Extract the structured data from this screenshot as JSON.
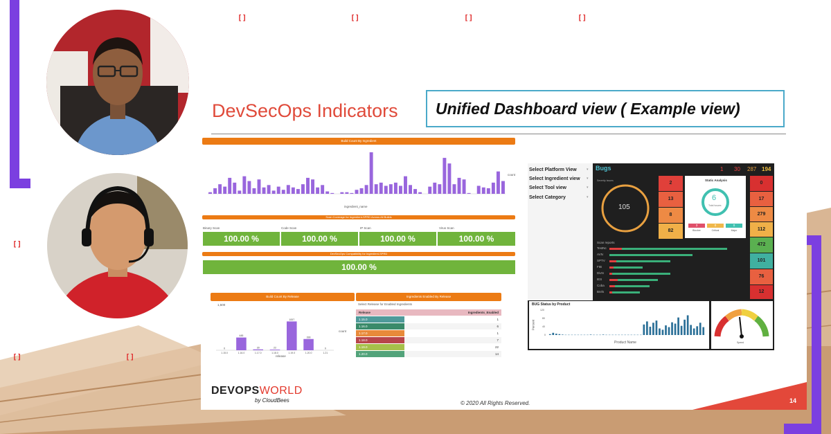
{
  "slide": {
    "title": "DevSecOps Indicators",
    "banner": "Unified Dashboard view ( Example view)",
    "footer_brand_a": "DEVOPS",
    "footer_brand_b": "WORLD",
    "footer_sub": "by CloudBees",
    "copyright": "© 2020 All Rights Reserved.",
    "page_number": "14"
  },
  "window_icons": [
    "[]",
    "[]",
    "[]",
    "[]",
    "[]",
    "[]",
    "[]"
  ],
  "build_count_ingredient": {
    "header": "Build Count By Ingredient",
    "legend": "count",
    "xlabel": "ingredient_name"
  },
  "coverage": {
    "header": "Scan Coverage for Ingredient-SPRD Across All Builds",
    "labels": [
      "Binary Scan",
      "Code Scan",
      "IP Scan",
      "Virus Scan"
    ],
    "values": [
      "100.00 %",
      "100.00 %",
      "100.00 %",
      "100.00 %"
    ],
    "compat_header": "DevSecOps Compatibility for Ingredient-SPRD",
    "compat_value": "100.00 %"
  },
  "build_count_release": {
    "header": "Build Count By Release",
    "legend": "count",
    "xlabel": "release",
    "ylabel": "count",
    "ytick_top": "1,500"
  },
  "ingredients_release": {
    "header": "Ingredients Enabled By Release",
    "subheader": "Select Release for Enabled Ingredients",
    "col_release": "Release",
    "col_enabled": "Ingredients_Enabled",
    "rows": [
      {
        "release": "1.15.0",
        "count": "1",
        "color": "#4f9a9a"
      },
      {
        "release": "1.16.0",
        "count": "6",
        "color": "#3a8a6a"
      },
      {
        "release": "1.17.0",
        "count": "1",
        "color": "#e88a3a"
      },
      {
        "release": "1.18.0",
        "count": "7",
        "color": "#b8454a"
      },
      {
        "release": "1.19.0",
        "count": "22",
        "color": "#a6c04a"
      },
      {
        "release": "1.20.0",
        "count": "14",
        "color": "#52a37a"
      }
    ]
  },
  "dashboard": {
    "filters": [
      "Select Platform View",
      "Select Ingredient view",
      "Select Tool view",
      "Select Category"
    ],
    "bugs_title": "Bugs",
    "counts": [
      "1",
      "30",
      "287",
      "194"
    ],
    "gauge_value": "105",
    "severity_label": "Severity Issues",
    "static_title": "Static Analysis",
    "static_total": "6",
    "static_total_label": "Total Issues",
    "static_tiles": [
      {
        "value": "3",
        "label": "Blocker",
        "color": "#e0506a"
      },
      {
        "value": "0",
        "label": "Critical",
        "color": "#f0b84a"
      },
      {
        "value": "0",
        "label": "Major",
        "color": "#40c0b0"
      }
    ],
    "mid_cells": [
      "2",
      "13",
      "8",
      "82"
    ],
    "right_cells": [
      "0",
      "17",
      "279",
      "112",
      "472",
      "101",
      "76",
      "12"
    ],
    "scan_title": "Scan reports",
    "scan_labels": [
      "TestNc",
      "AVN",
      "SPTV",
      "FIB",
      "DivN",
      "IES",
      "Coba",
      "Bnrls"
    ],
    "bug_status_title": "BUG Status by Product",
    "bug_status_ylabel": "Percent",
    "bug_status_xlabel": "Product Name",
    "bug_yticks": [
      "120",
      "80",
      "40",
      "0"
    ],
    "gauge_label": "Speed"
  },
  "chart_data": [
    {
      "type": "bar",
      "title": "Build Count By Ingredient",
      "xlabel": "ingredient_name",
      "legend": [
        "count"
      ],
      "values": [
        2,
        7,
        12,
        9,
        20,
        14,
        4,
        22,
        16,
        7,
        18,
        8,
        11,
        4,
        9,
        5,
        11,
        8,
        6,
        12,
        20,
        18,
        8,
        11,
        3,
        1,
        0,
        2,
        2,
        1,
        5,
        7,
        11,
        52,
        12,
        14,
        10,
        12,
        14,
        10,
        22,
        11,
        6,
        2,
        0,
        9,
        14,
        12,
        45,
        38,
        12,
        20,
        18,
        1,
        0,
        10,
        8,
        7,
        14,
        28,
        16
      ]
    },
    {
      "type": "bar",
      "title": "Build Count By Release",
      "xlabel": "release",
      "ylabel": "count",
      "legend": [
        "count"
      ],
      "categories": [
        "1.15.0",
        "1.16.0",
        "1.17.0",
        "1.18.0",
        "1.19.0",
        "1.20.0",
        "1.21"
      ],
      "values": [
        0,
        445,
        30,
        22,
        1007,
        393,
        0
      ],
      "labels": [
        "0",
        "445",
        "30",
        "22",
        "1007",
        "393",
        "0"
      ],
      "ylim": [
        0,
        1500
      ]
    },
    {
      "type": "bar",
      "title": "BUG Status by Product",
      "xlabel": "Product Name",
      "ylabel": "Percent",
      "values": [
        4,
        10,
        6,
        4,
        2,
        1,
        1,
        1,
        1,
        1,
        1,
        1,
        1,
        2,
        1,
        1,
        1,
        2,
        1,
        1,
        1,
        1,
        1,
        1,
        1,
        1,
        1,
        1,
        1,
        1,
        48,
        62,
        38,
        56,
        66,
        30,
        24,
        44,
        36,
        58,
        52,
        80,
        42,
        70,
        90,
        46,
        30,
        40,
        56,
        36
      ],
      "ylim": [
        0,
        120
      ]
    }
  ]
}
